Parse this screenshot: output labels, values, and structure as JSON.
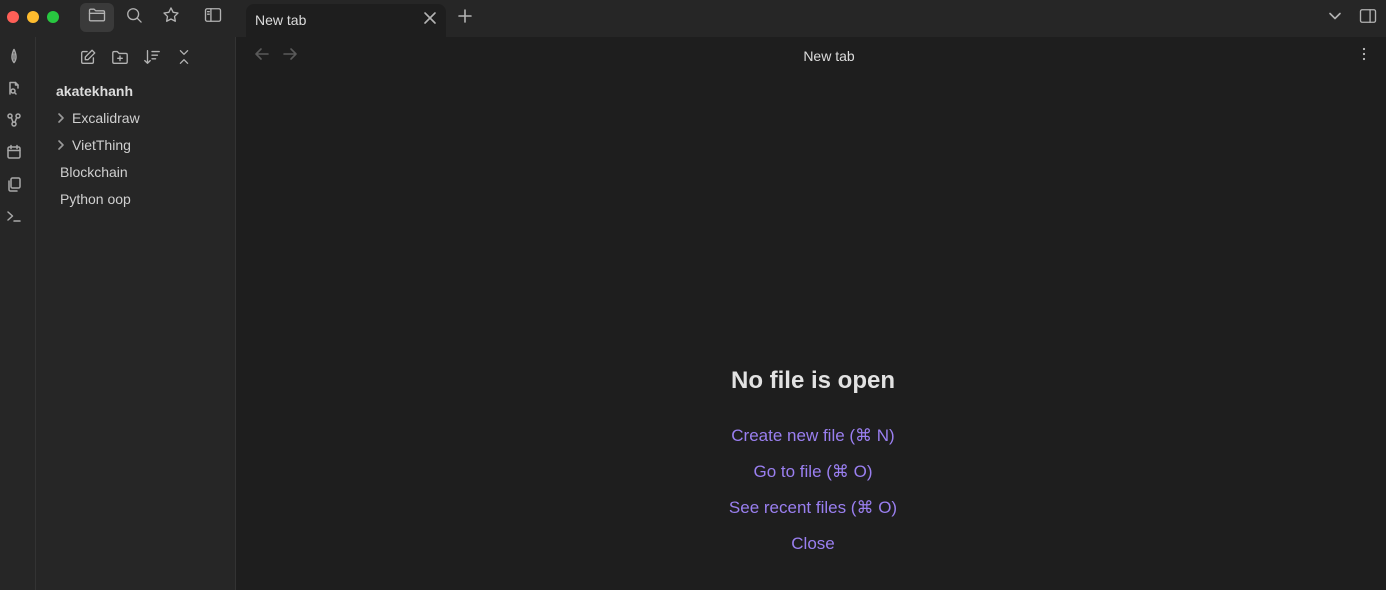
{
  "tab": {
    "title": "New tab"
  },
  "header": {
    "title": "New tab"
  },
  "sidebar": {
    "vault_name": "akatekhanh",
    "items": [
      {
        "label": "Excalidraw",
        "type": "folder"
      },
      {
        "label": "VietThing",
        "type": "folder"
      },
      {
        "label": "Blockchain",
        "type": "file"
      },
      {
        "label": "Python oop",
        "type": "file"
      }
    ]
  },
  "empty_state": {
    "title": "No file is open",
    "actions": [
      "Create new file (⌘ N)",
      "Go to file (⌘ O)",
      "See recent files (⌘ O)",
      "Close"
    ]
  },
  "colors": {
    "accent": "#9a7ff0",
    "background": "#1e1e1e",
    "sidebar": "#262626"
  }
}
